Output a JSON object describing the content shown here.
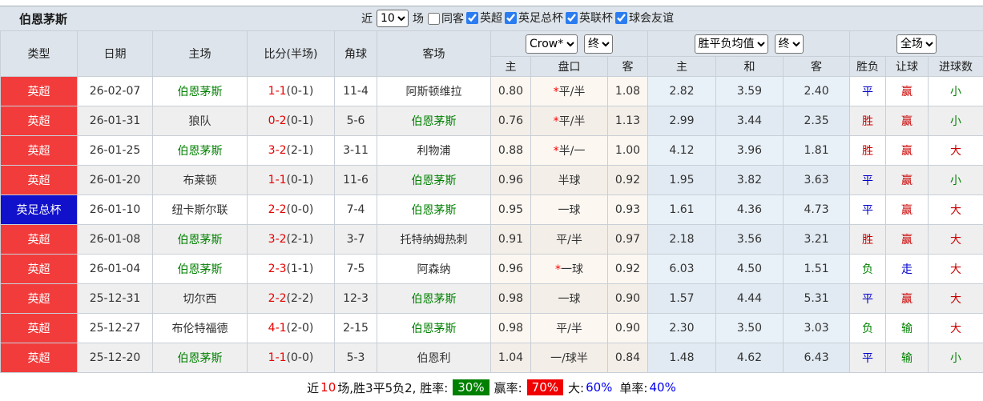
{
  "title": "伯恩茅斯",
  "filters": {
    "near_label": "近",
    "matches_value": "10",
    "matches_label": "场",
    "same_away": {
      "label": "同客",
      "checked": false
    },
    "competitions": [
      {
        "label": "英超",
        "checked": true
      },
      {
        "label": "英足总杯",
        "checked": true
      },
      {
        "label": "英联杯",
        "checked": true
      },
      {
        "label": "球会友谊",
        "checked": true
      }
    ]
  },
  "table": {
    "static_headers": [
      "类型",
      "日期",
      "主场",
      "比分(半场)",
      "角球",
      "客场"
    ],
    "selects": {
      "odds_source": "Crow*",
      "odds_time": "终",
      "mean_label": "胜平负均值",
      "mean_time": "终",
      "scope": "全场"
    },
    "sub_headers": [
      "主",
      "盘口",
      "客",
      "主",
      "和",
      "客",
      "胜负",
      "让球",
      "进球数"
    ],
    "rows": [
      {
        "type": "英超",
        "type_color": "red",
        "date": "26-02-07",
        "home": "伯恩茅斯",
        "home_green": true,
        "score": "1-1",
        "half": "(0-1)",
        "corners": "11-4",
        "away": "阿斯顿维拉",
        "away_green": false,
        "odds_home": "0.80",
        "handicap_star": true,
        "handicap": "平/半",
        "odds_away": "1.08",
        "mean_home": "2.82",
        "mean_draw": "3.59",
        "mean_away": "2.40",
        "result": "平",
        "result_color": "blue",
        "handicap_result": "赢",
        "handicap_result_color": "red",
        "goals": "小",
        "goals_color": "green"
      },
      {
        "type": "英超",
        "type_color": "red",
        "date": "26-01-31",
        "home": "狼队",
        "home_green": false,
        "score": "0-2",
        "half": "(0-1)",
        "corners": "5-6",
        "away": "伯恩茅斯",
        "away_green": true,
        "odds_home": "0.76",
        "handicap_star": true,
        "handicap": "平/半",
        "odds_away": "1.13",
        "mean_home": "2.99",
        "mean_draw": "3.44",
        "mean_away": "2.35",
        "result": "胜",
        "result_color": "red",
        "handicap_result": "赢",
        "handicap_result_color": "red",
        "goals": "小",
        "goals_color": "green"
      },
      {
        "type": "英超",
        "type_color": "red",
        "date": "26-01-25",
        "home": "伯恩茅斯",
        "home_green": true,
        "score": "3-2",
        "half": "(2-1)",
        "corners": "3-11",
        "away": "利物浦",
        "away_green": false,
        "odds_home": "0.88",
        "handicap_star": true,
        "handicap": "半/一",
        "odds_away": "1.00",
        "mean_home": "4.12",
        "mean_draw": "3.96",
        "mean_away": "1.81",
        "result": "胜",
        "result_color": "red",
        "handicap_result": "赢",
        "handicap_result_color": "red",
        "goals": "大",
        "goals_color": "red"
      },
      {
        "type": "英超",
        "type_color": "red",
        "date": "26-01-20",
        "home": "布莱顿",
        "home_green": false,
        "score": "1-1",
        "half": "(0-1)",
        "corners": "11-6",
        "away": "伯恩茅斯",
        "away_green": true,
        "odds_home": "0.96",
        "handicap_star": false,
        "handicap": "半球",
        "odds_away": "0.92",
        "mean_home": "1.95",
        "mean_draw": "3.82",
        "mean_away": "3.63",
        "result": "平",
        "result_color": "blue",
        "handicap_result": "赢",
        "handicap_result_color": "red",
        "goals": "小",
        "goals_color": "green"
      },
      {
        "type": "英足总杯",
        "type_color": "blue",
        "date": "26-01-10",
        "home": "纽卡斯尔联",
        "home_green": false,
        "score": "2-2",
        "half": "(0-0)",
        "corners": "7-4",
        "away": "伯恩茅斯",
        "away_green": true,
        "odds_home": "0.95",
        "handicap_star": false,
        "handicap": "一球",
        "odds_away": "0.93",
        "mean_home": "1.61",
        "mean_draw": "4.36",
        "mean_away": "4.73",
        "result": "平",
        "result_color": "blue",
        "handicap_result": "赢",
        "handicap_result_color": "red",
        "goals": "大",
        "goals_color": "red"
      },
      {
        "type": "英超",
        "type_color": "red",
        "date": "26-01-08",
        "home": "伯恩茅斯",
        "home_green": true,
        "score": "3-2",
        "half": "(2-1)",
        "corners": "3-7",
        "away": "托特纳姆热刺",
        "away_green": false,
        "odds_home": "0.91",
        "handicap_star": false,
        "handicap": "平/半",
        "odds_away": "0.97",
        "mean_home": "2.18",
        "mean_draw": "3.56",
        "mean_away": "3.21",
        "result": "胜",
        "result_color": "red",
        "handicap_result": "赢",
        "handicap_result_color": "red",
        "goals": "大",
        "goals_color": "red"
      },
      {
        "type": "英超",
        "type_color": "red",
        "date": "26-01-04",
        "home": "伯恩茅斯",
        "home_green": true,
        "score": "2-3",
        "half": "(1-1)",
        "corners": "7-5",
        "away": "阿森纳",
        "away_green": false,
        "odds_home": "0.96",
        "handicap_star": true,
        "handicap": "一球",
        "odds_away": "0.92",
        "mean_home": "6.03",
        "mean_draw": "4.50",
        "mean_away": "1.51",
        "result": "负",
        "result_color": "green",
        "handicap_result": "走",
        "handicap_result_color": "blue",
        "goals": "大",
        "goals_color": "red"
      },
      {
        "type": "英超",
        "type_color": "red",
        "date": "25-12-31",
        "home": "切尔西",
        "home_green": false,
        "score": "2-2",
        "half": "(2-2)",
        "corners": "12-3",
        "away": "伯恩茅斯",
        "away_green": true,
        "odds_home": "0.98",
        "handicap_star": false,
        "handicap": "一球",
        "odds_away": "0.90",
        "mean_home": "1.57",
        "mean_draw": "4.44",
        "mean_away": "5.31",
        "result": "平",
        "result_color": "blue",
        "handicap_result": "赢",
        "handicap_result_color": "red",
        "goals": "大",
        "goals_color": "red"
      },
      {
        "type": "英超",
        "type_color": "red",
        "date": "25-12-27",
        "home": "布伦特福德",
        "home_green": false,
        "score": "4-1",
        "half": "(2-0)",
        "corners": "2-15",
        "away": "伯恩茅斯",
        "away_green": true,
        "odds_home": "0.98",
        "handicap_star": false,
        "handicap": "平/半",
        "odds_away": "0.90",
        "mean_home": "2.30",
        "mean_draw": "3.50",
        "mean_away": "3.03",
        "result": "负",
        "result_color": "green",
        "handicap_result": "输",
        "handicap_result_color": "green",
        "goals": "大",
        "goals_color": "red"
      },
      {
        "type": "英超",
        "type_color": "red",
        "date": "25-12-20",
        "home": "伯恩茅斯",
        "home_green": true,
        "score": "1-1",
        "half": "(0-0)",
        "corners": "5-3",
        "away": "伯恩利",
        "away_green": false,
        "odds_home": "1.04",
        "handicap_star": false,
        "handicap": "一/球半",
        "odds_away": "0.84",
        "mean_home": "1.48",
        "mean_draw": "4.62",
        "mean_away": "6.43",
        "result": "平",
        "result_color": "blue",
        "handicap_result": "输",
        "handicap_result_color": "green",
        "goals": "小",
        "goals_color": "green"
      }
    ]
  },
  "footer": {
    "near_label": "近",
    "near_count": "10",
    "summary": "场,胜3平5负2, 胜率:",
    "win_rate": "30%",
    "handicap_win_label": "赢率:",
    "handicap_win_rate": "70%",
    "big_label": "大:",
    "big_rate": "60%",
    "single_label": "单率:",
    "single_rate": "40%"
  },
  "colors": {
    "header_bg": "#dde4eb",
    "type_red": "#f23c3c",
    "type_blue": "#1111cc",
    "team_green": "#008000",
    "score_red": "#e60000",
    "text_red": "#cc0000",
    "text_blue": "#0000cc",
    "text_green": "#008000",
    "badge_green": "#008000",
    "badge_red": "#f00000",
    "pct_blue": "#0000ee",
    "mean_col_bg": "#e9f1f8",
    "crow_col_bg": "#fcf7f1"
  }
}
